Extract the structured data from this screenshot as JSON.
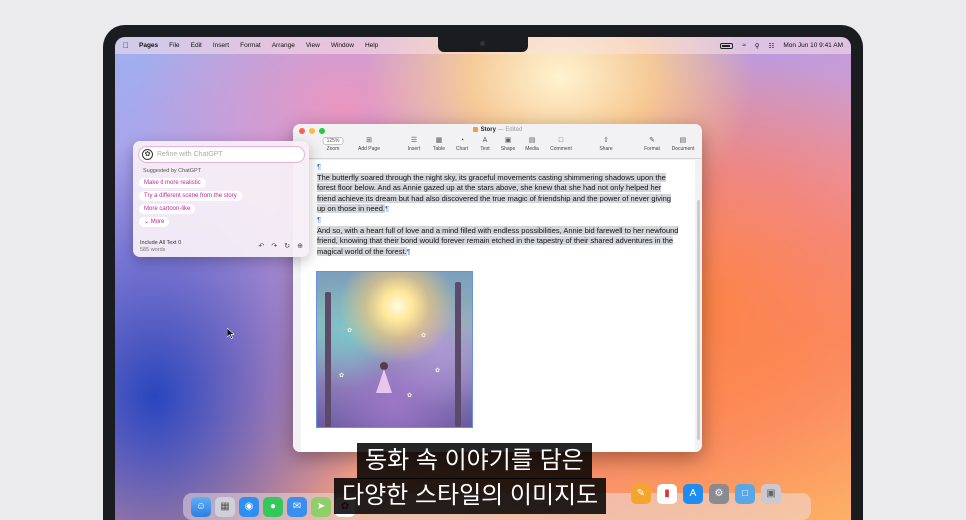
{
  "menubar": {
    "app": "Pages",
    "items": [
      "File",
      "Edit",
      "Insert",
      "Format",
      "Arrange",
      "View",
      "Window",
      "Help"
    ],
    "datetime": "Mon Jun 10  9:41 AM"
  },
  "window": {
    "title": "Story",
    "title_status": "— Edited",
    "zoom": "125%",
    "toolbar": {
      "zoom": "Zoom",
      "add_page": "Add Page",
      "insert": "Insert",
      "table": "Table",
      "chart": "Chart",
      "text": "Text",
      "shape": "Shape",
      "media": "Media",
      "comment": "Comment",
      "share": "Share",
      "format": "Format",
      "document": "Document"
    },
    "paragraphs": [
      "The butterfly soared through the night sky, its graceful movements casting shimmering shadows upon the forest floor below. And as Annie gazed up at the stars above, she knew that she had not only helped her friend achieve its dream but had also discovered the true magic of friendship and the power of never giving up on those in need.",
      "And so, with a heart full of love and a mind filled with endless possibilities, Annie bid farewell to her newfound friend, knowing that their bond would forever remain etched in the tapestry of their shared adventures in the magical world of the forest."
    ],
    "pilcrow": "¶"
  },
  "writing_tools": {
    "placeholder": "Refine with ChatGPT",
    "suggested_title": "Suggested by ChatGPT",
    "suggestions": [
      "Make it more realistic",
      "Try a different scene from the story",
      "More cartoon-like"
    ],
    "more": "More",
    "footer_title": "Include All Text 0",
    "footer_sub": "585 words"
  },
  "subtitles": {
    "line1": "동화 속 이야기를 담은",
    "line2": "다양한 스타일의 이미지도"
  },
  "colors": {
    "accent_pink": "#c0279d",
    "selection": "#d4d6dc",
    "pilcrow": "#3b78d6"
  }
}
